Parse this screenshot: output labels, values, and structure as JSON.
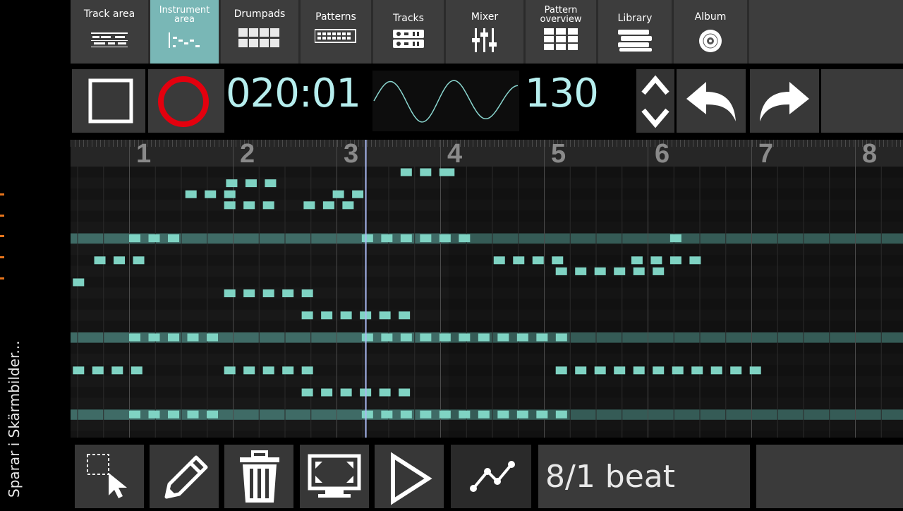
{
  "status": {
    "text": "Sparar i Skärmbilder..."
  },
  "tabs": [
    {
      "label": "Track area",
      "icon": "track-area-icon",
      "active": false
    },
    {
      "label": "Instrument area",
      "icon": "instrument-area-icon",
      "active": true
    },
    {
      "label": "Drumpads",
      "icon": "drumpads-icon",
      "active": false
    },
    {
      "label": "Patterns",
      "icon": "patterns-icon",
      "active": false
    },
    {
      "label": "Tracks",
      "icon": "tracks-icon",
      "active": false
    },
    {
      "label": "Mixer",
      "icon": "mixer-icon",
      "active": false
    },
    {
      "label": "Pattern overview",
      "icon": "pattern-overview-icon",
      "active": false
    },
    {
      "label": "Library",
      "icon": "library-icon",
      "active": false
    },
    {
      "label": "Album",
      "icon": "album-icon",
      "active": false
    }
  ],
  "transport": {
    "time": "020:01",
    "bpm": "130"
  },
  "piano_roll": {
    "bars": [
      "1",
      "2",
      "3",
      "4",
      "5",
      "6",
      "7",
      "8"
    ],
    "playhead_beat": 12.1
  },
  "bottom": {
    "beat_label": "8/1 beat"
  },
  "colors": {
    "accent": "#79b7b6",
    "note": "#7fd3c3",
    "record": "#e4000e",
    "text_cyan": "#b6eeee"
  }
}
